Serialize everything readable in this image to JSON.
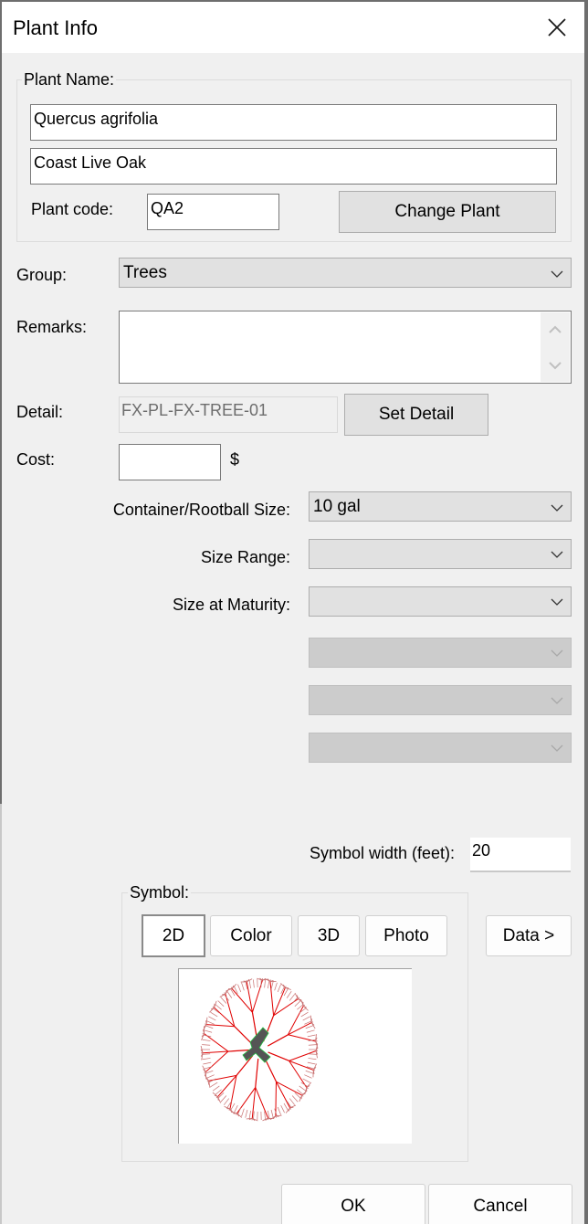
{
  "window": {
    "title": "Plant Info",
    "close_icon": "close-icon"
  },
  "plant_name": {
    "legend": "Plant Name:",
    "scientific_name": "Quercus agrifolia",
    "common_name": "Coast Live Oak",
    "plant_code_label": "Plant code:",
    "plant_code": "QA2",
    "change_plant_label": "Change Plant"
  },
  "group": {
    "label": "Group:",
    "value": "Trees"
  },
  "remarks": {
    "label": "Remarks:",
    "value": ""
  },
  "detail": {
    "label": "Detail:",
    "value": "FX-PL-FX-TREE-01",
    "set_detail_label": "Set Detail"
  },
  "cost": {
    "label": "Cost:",
    "value": "",
    "currency": "$"
  },
  "sizes": {
    "container_label": "Container/Rootball Size:",
    "container_value": "10 gal",
    "size_range_label": "Size Range:",
    "size_range_value": "",
    "maturity_label": "Size at Maturity:",
    "maturity_value": "",
    "extra_dropdowns": [
      "",
      "",
      ""
    ]
  },
  "symbol_width": {
    "label": "Symbol width (feet):",
    "value": "20"
  },
  "symbol": {
    "legend": "Symbol:",
    "tabs": [
      {
        "label": "2D",
        "selected": true
      },
      {
        "label": "Color",
        "selected": false
      },
      {
        "label": "3D",
        "selected": false
      },
      {
        "label": "Photo",
        "selected": false
      }
    ],
    "data_button_label": "Data >",
    "preview": "tree-plan-symbol"
  },
  "footer": {
    "ok_label": "OK",
    "cancel_label": "Cancel"
  },
  "colors": {
    "branch_red": "#e00000",
    "branch_pink": "#c87070",
    "trunk_gray": "#555555",
    "outline_green": "#22c040"
  }
}
